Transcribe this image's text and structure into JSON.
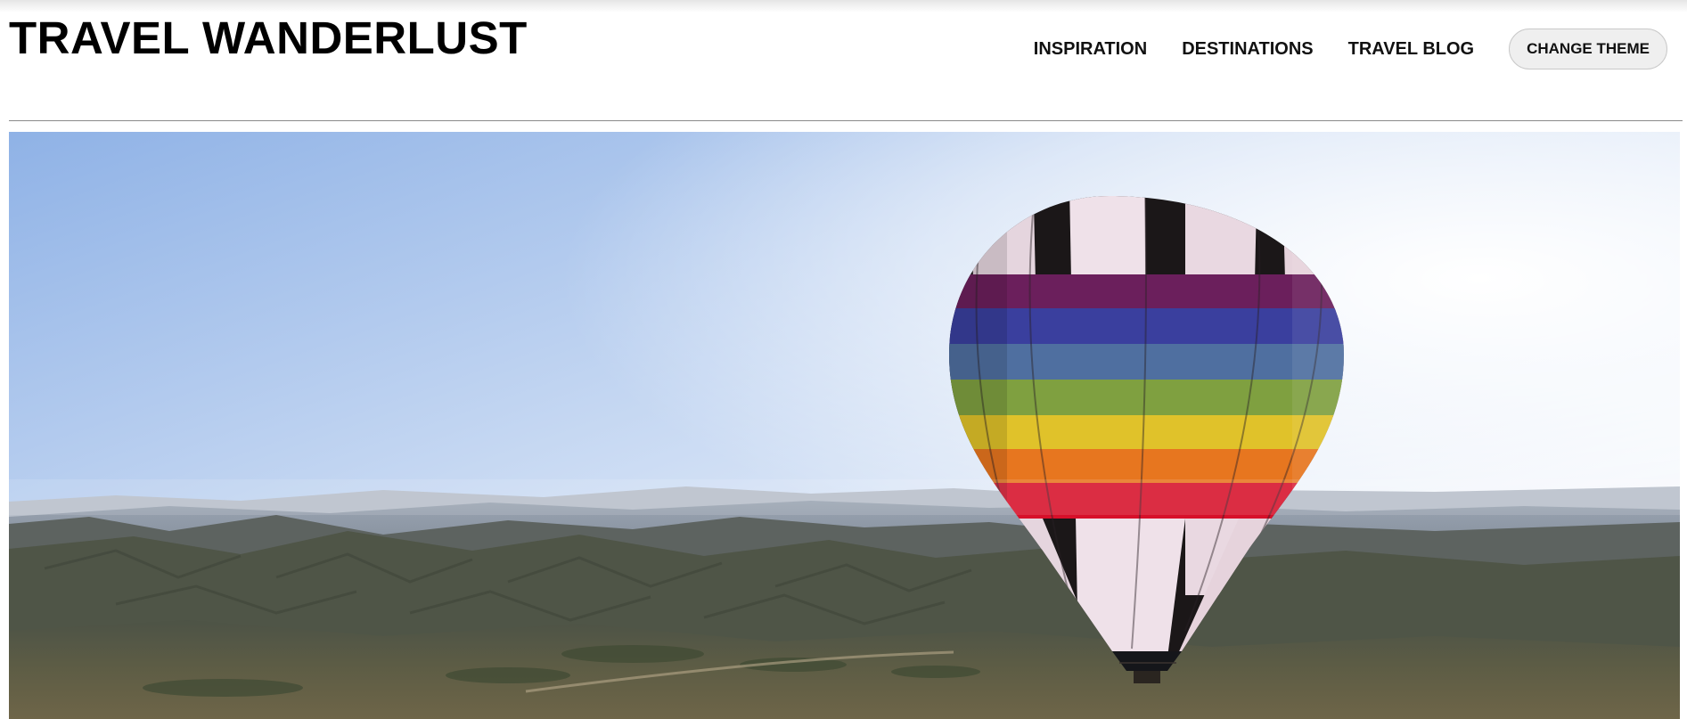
{
  "header": {
    "title": "TRAVEL WANDERLUST"
  },
  "nav": {
    "items": [
      {
        "label": "INSPIRATION"
      },
      {
        "label": "DESTINATIONS"
      },
      {
        "label": "TRAVEL BLOG"
      }
    ],
    "theme_button_label": "CHANGE THEME"
  },
  "hero": {
    "image": "hot-air-balloon-over-desert-mountains",
    "balloon_stripes": [
      "#6b1f5c",
      "#3a3f9e",
      "#4f6fa0",
      "#7fa040",
      "#e0c22a",
      "#e7761f",
      "#d7102a"
    ]
  }
}
